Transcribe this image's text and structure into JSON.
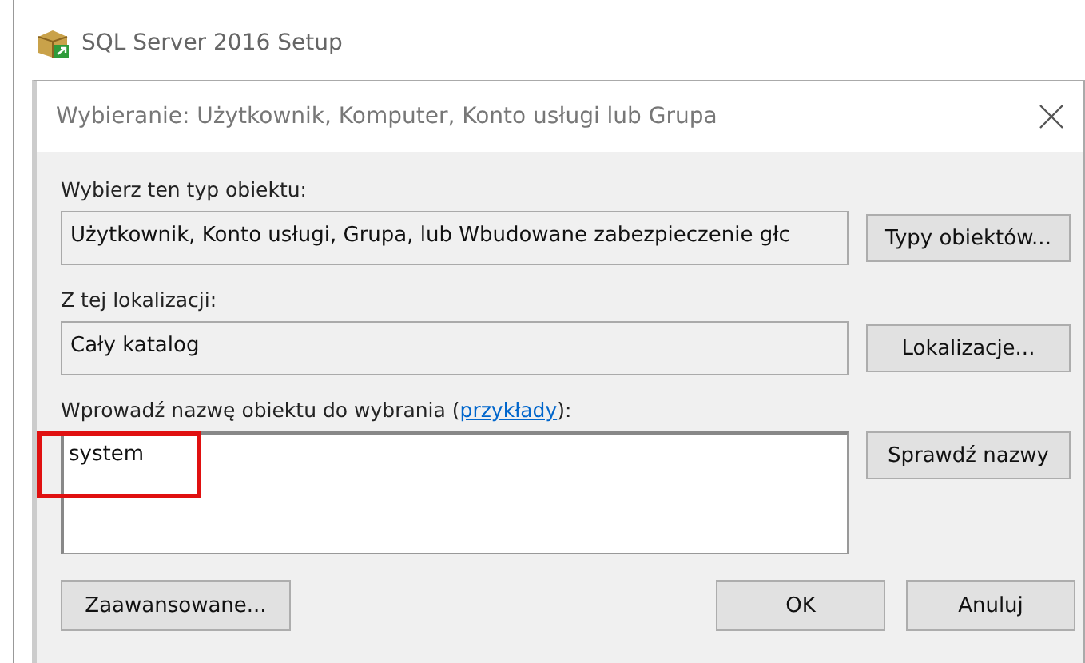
{
  "window": {
    "title": "SQL Server 2016 Setup"
  },
  "dialog": {
    "title": "Wybieranie: Użytkownik, Komputer, Konto usługi lub Grupa",
    "object_type": {
      "label": "Wybierz ten typ obiektu:",
      "value": "Użytkownik, Konto usługi, Grupa, lub Wbudowane zabezpieczenie głc",
      "button": "Typy obiektów..."
    },
    "location": {
      "label": "Z tej lokalizacji:",
      "value": "Cały katalog",
      "button": "Lokalizacje..."
    },
    "names": {
      "label": "Wprowadź nazwę obiektu do wybrania (",
      "link": "przykłady",
      "label_end": "):",
      "value": "system",
      "button": "Sprawdź nazwy"
    },
    "buttons": [
      {
        "label": "Zaawansowane..."
      },
      {
        "label": "OK"
      },
      {
        "label": "Anuluj"
      }
    ]
  }
}
